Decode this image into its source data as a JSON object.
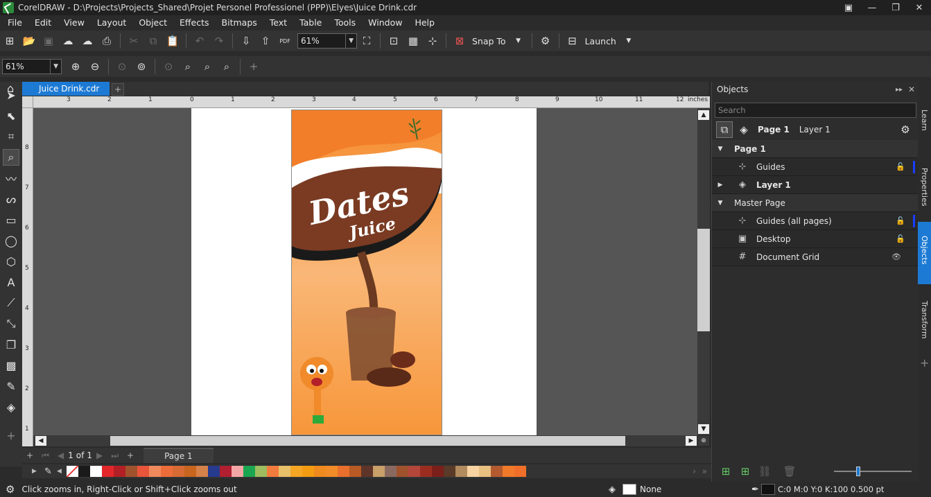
{
  "window": {
    "title": "CorelDRAW - D:\\Projects\\Projects_Shared\\Projet Personel Professionel (PPP)\\Elyes\\Juice Drink.cdr"
  },
  "menu": [
    "File",
    "Edit",
    "View",
    "Layout",
    "Object",
    "Effects",
    "Bitmaps",
    "Text",
    "Table",
    "Tools",
    "Window",
    "Help"
  ],
  "toolbar": {
    "zoom_value": "61%",
    "snap_label": "Snap To",
    "launch_label": "Launch"
  },
  "toolbar2": {
    "zoom_value": "61%"
  },
  "doc": {
    "tab_label": "Juice Drink.cdr"
  },
  "ruler": {
    "units": "inches",
    "h_ticks": [
      "3",
      "2",
      "1",
      "0",
      "1",
      "2",
      "3",
      "4",
      "5",
      "6",
      "7",
      "8",
      "9",
      "10",
      "11",
      "12"
    ],
    "v_ticks": [
      "8",
      "7",
      "6",
      "5",
      "4",
      "3",
      "2",
      "1"
    ]
  },
  "design": {
    "title": "Dates",
    "subtitle": "Juice"
  },
  "pagenav": {
    "current": "1",
    "of_label": "of",
    "total": "1",
    "page_tab": "Page 1"
  },
  "palette": [
    "#ffffff",
    "#1a1a1a",
    "#ffffff",
    "#e3262a",
    "#b21f24",
    "#a0522d",
    "#e8553a",
    "#f08a5d",
    "#ed6d3a",
    "#d86a34",
    "#c8651f",
    "#d5814a",
    "#263a8e",
    "#b02030",
    "#f4a6a6",
    "#1aa650",
    "#9ebd5f",
    "#f27b3e",
    "#e8c06a",
    "#f5a623",
    "#f39c12",
    "#ef8a1e",
    "#f28c28",
    "#e86f2c",
    "#b85a24",
    "#5e3528",
    "#c9a06a",
    "#8a6a60",
    "#a0522d",
    "#b5463c",
    "#9b2d20",
    "#7a1f1a",
    "#5a3a28",
    "#b28b5e",
    "#f7d3a1",
    "#e8c080",
    "#b35a30",
    "#f07a2a",
    "#ef6f2a"
  ],
  "status": {
    "hint": "Click zooms in, Right-Click or Shift+Click zooms out",
    "fill_label": "None",
    "outline": "C:0 M:0 Y:0 K:100  0.500 pt"
  },
  "panel": {
    "title": "Objects",
    "search_placeholder": "Search",
    "current_page": "Page 1",
    "current_layer": "Layer 1",
    "rows": [
      {
        "label": "Page 1",
        "kind": "header"
      },
      {
        "label": "Guides",
        "kind": "item"
      },
      {
        "label": "Layer 1",
        "kind": "item"
      },
      {
        "label": "Master Page",
        "kind": "header"
      },
      {
        "label": "Guides (all pages)",
        "kind": "item"
      },
      {
        "label": "Desktop",
        "kind": "item"
      },
      {
        "label": "Document Grid",
        "kind": "item"
      }
    ]
  },
  "sidetabs": [
    "Learn",
    "Properties",
    "Objects",
    "Transform"
  ]
}
